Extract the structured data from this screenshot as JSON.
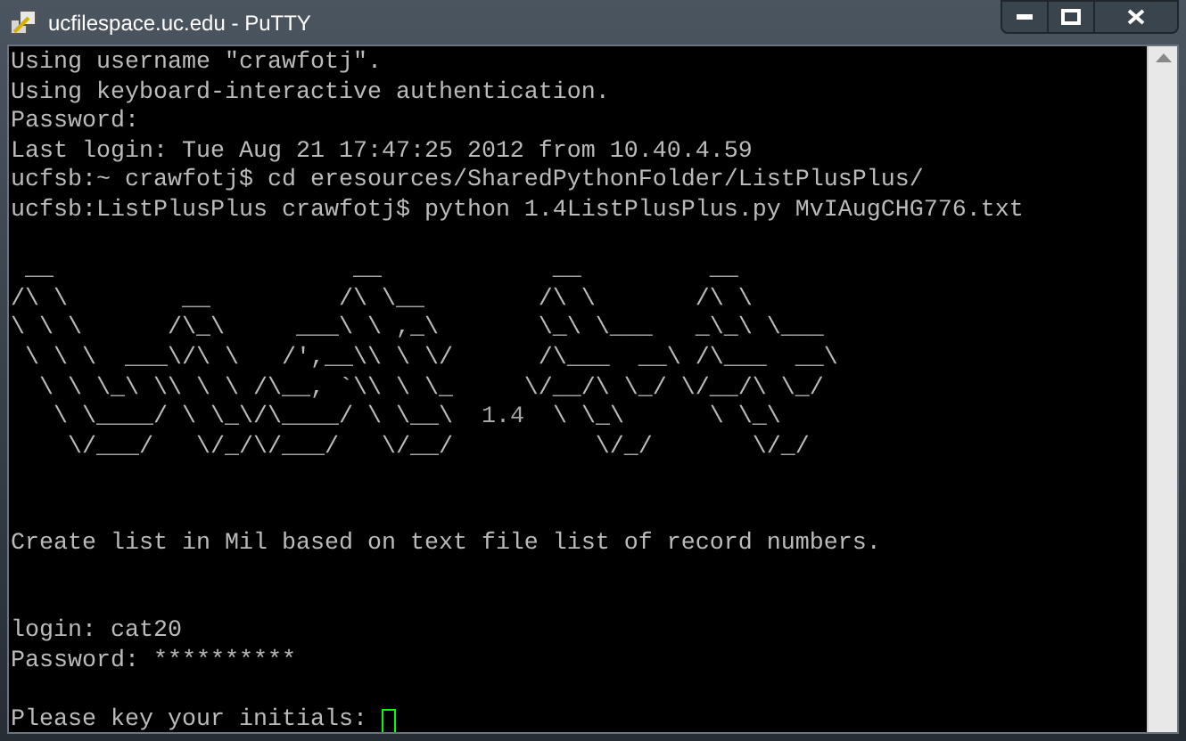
{
  "window": {
    "title": "ucfilespace.uc.edu - PuTTY"
  },
  "session_lines": [
    "Using username \"crawfotj\".",
    "Using keyboard-interactive authentication.",
    "Password:",
    "Last login: Tue Aug 21 17:47:25 2012 from 10.40.4.59",
    "ucfsb:~ crawfotj$ cd eresources/SharedPythonFolder/ListPlusPlus/",
    "ucfsb:ListPlusPlus crawfotj$ python 1.4ListPlusPlus.py MvIAugCHG776.txt"
  ],
  "banner": {
    "lines": [
      {
        "text": " __                     __            __         __"
      },
      {
        "text": "/\\ \\        __         /\\ \\__        /\\ \\       /\\ \\"
      },
      {
        "text": "\\ \\ \\      /\\_\\     ___\\ \\ ,_\\       \\_\\ \\___   _\\_\\ \\___"
      },
      {
        "text": " \\ \\ \\  ___\\/\\ \\   /',__\\\\ \\ \\/      /\\___  __\\ /\\___  __\\"
      },
      {
        "text": "  \\ \\ \\_\\ \\\\ \\ \\ /\\__, `\\\\ \\ \\_     \\/__/\\ \\_/ \\/__/\\ \\_/"
      },
      {
        "text": "   \\ \\____/ \\ \\_\\/\\____/ \\ \\__\\",
        "version": "1.4",
        "rest": "  \\ \\_\\      \\ \\_\\"
      },
      {
        "text": "    \\/___/   \\/_/\\/___/   \\/__/          \\/_/       \\/_/"
      }
    ]
  },
  "message": "Create list in Mil based on text file list of record numbers.",
  "login_lines": [
    "login: cat20",
    "Password: **********"
  ],
  "prompt": "Please key your initials: "
}
